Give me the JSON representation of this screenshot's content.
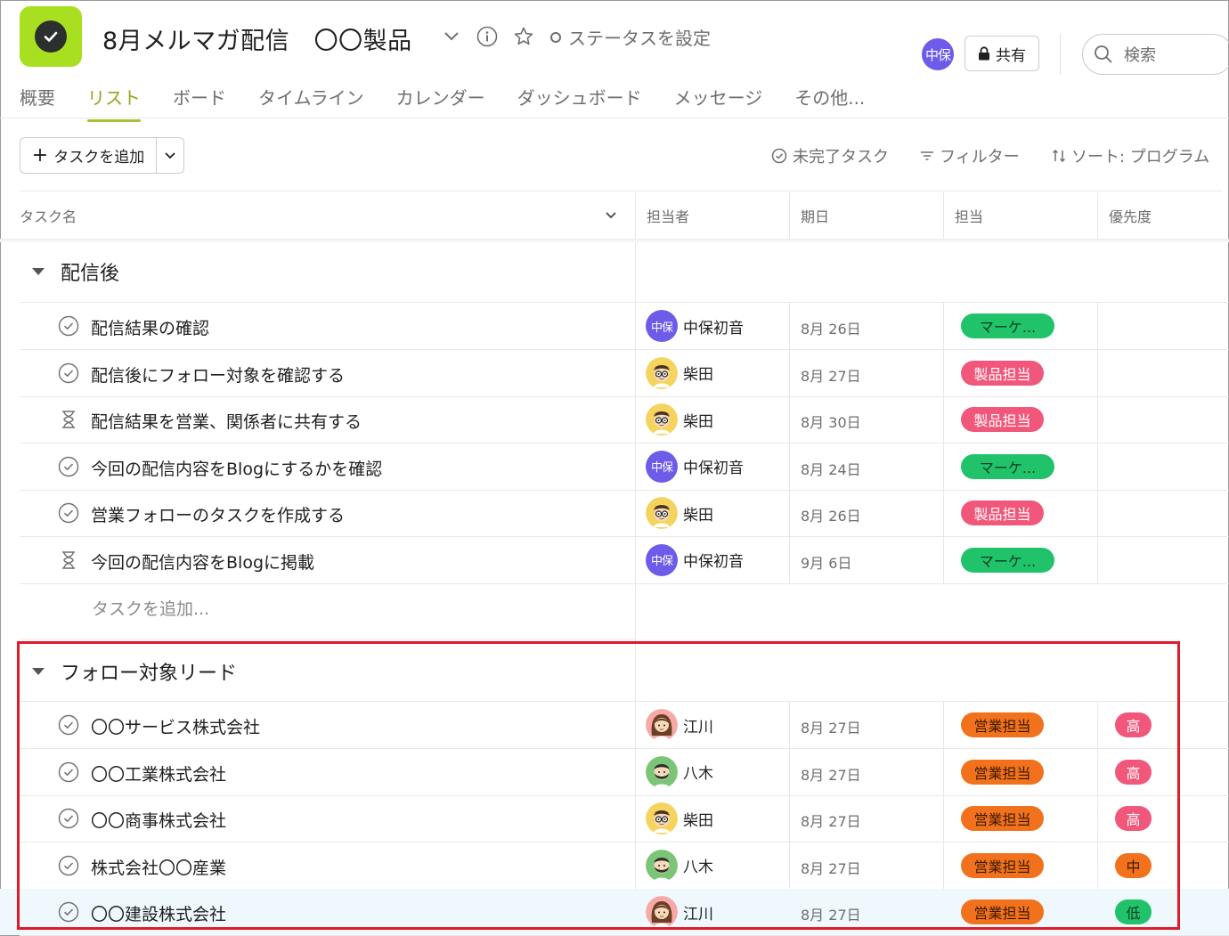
{
  "project": {
    "title": "8月メルマガ配信　〇〇製品",
    "status_label": "ステータスを設定",
    "members_avatar": "中保",
    "share_label": "共有",
    "search_placeholder": "検索"
  },
  "tabs": [
    "概要",
    "リスト",
    "ボード",
    "タイムライン",
    "カレンダー",
    "ダッシュボード",
    "メッセージ",
    "その他..."
  ],
  "active_tab": "リスト",
  "toolbar": {
    "add_task": "タスクを追加",
    "incomplete": "未完了タスク",
    "filter": "フィルター",
    "sort": "ソート: プログラム"
  },
  "columns": {
    "task": "タスク名",
    "assignee": "担当者",
    "due": "期日",
    "owner": "担当",
    "priority": "優先度"
  },
  "sections": [
    {
      "name": "配信後",
      "tasks": [
        {
          "name": "配信結果の確認",
          "status": "check",
          "assignee": "中保初音",
          "avatar": "中保",
          "avatar_type": "purple",
          "due": "8月 26日",
          "tag": "マーケ...",
          "tag_color": "green",
          "priority": ""
        },
        {
          "name": "配信後にフォロー対象を確認する",
          "status": "check",
          "assignee": "柴田",
          "avatar_type": "glasses",
          "due": "8月 27日",
          "tag": "製品担当",
          "tag_color": "pink",
          "priority": ""
        },
        {
          "name": "配信結果を営業、関係者に共有する",
          "status": "hourglass",
          "assignee": "柴田",
          "avatar_type": "glasses",
          "due": "8月 30日",
          "tag": "製品担当",
          "tag_color": "pink",
          "priority": ""
        },
        {
          "name": "今回の配信内容をBlogにするかを確認",
          "status": "check",
          "assignee": "中保初音",
          "avatar": "中保",
          "avatar_type": "purple",
          "due": "8月 24日",
          "tag": "マーケ...",
          "tag_color": "green",
          "priority": ""
        },
        {
          "name": "営業フォローのタスクを作成する",
          "status": "check",
          "assignee": "柴田",
          "avatar_type": "glasses",
          "due": "8月 26日",
          "tag": "製品担当",
          "tag_color": "pink",
          "priority": ""
        },
        {
          "name": "今回の配信内容をBlogに掲載",
          "status": "hourglass",
          "assignee": "中保初音",
          "avatar": "中保",
          "avatar_type": "purple",
          "due": "9月 6日",
          "tag": "マーケ...",
          "tag_color": "green",
          "priority": ""
        }
      ],
      "add_task_label": "タスクを追加..."
    },
    {
      "name": "フォロー対象リード",
      "tasks": [
        {
          "name": "〇〇サービス株式会社",
          "status": "check",
          "assignee": "江川",
          "avatar_type": "woman",
          "due": "8月 27日",
          "tag": "営業担当",
          "tag_color": "orange",
          "priority": "高",
          "priority_level": "high"
        },
        {
          "name": "〇〇工業株式会社",
          "status": "check",
          "assignee": "八木",
          "avatar_type": "beard",
          "due": "8月 27日",
          "tag": "営業担当",
          "tag_color": "orange",
          "priority": "高",
          "priority_level": "high"
        },
        {
          "name": "〇〇商事株式会社",
          "status": "check",
          "assignee": "柴田",
          "avatar_type": "glasses",
          "due": "8月 27日",
          "tag": "営業担当",
          "tag_color": "orange",
          "priority": "高",
          "priority_level": "high"
        },
        {
          "name": "株式会社〇〇産業",
          "status": "check",
          "assignee": "八木",
          "avatar_type": "beard",
          "due": "8月 27日",
          "tag": "営業担当",
          "tag_color": "orange",
          "priority": "中",
          "priority_level": "mid"
        },
        {
          "name": "〇〇建設株式会社",
          "status": "check",
          "assignee": "江川",
          "avatar_type": "woman",
          "due": "8月 27日",
          "tag": "営業担当",
          "tag_color": "orange",
          "priority": "低",
          "priority_level": "low",
          "highlighted": true
        }
      ]
    }
  ],
  "colors": {
    "accent": "#a6c238",
    "green_tag": "#21c36a",
    "pink_tag": "#f0577a",
    "orange_tag": "#f2711c",
    "highlight_box": "#e11a2a"
  }
}
